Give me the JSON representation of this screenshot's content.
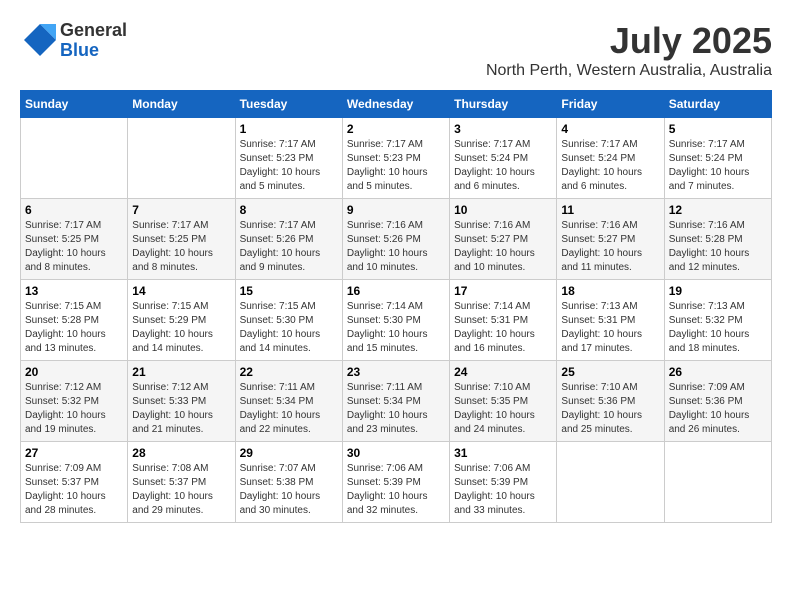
{
  "logo": {
    "line1": "General",
    "line2": "Blue"
  },
  "title": "July 2025",
  "subtitle": "North Perth, Western Australia, Australia",
  "weekdays": [
    "Sunday",
    "Monday",
    "Tuesday",
    "Wednesday",
    "Thursday",
    "Friday",
    "Saturday"
  ],
  "weeks": [
    [
      {
        "day": "",
        "info": ""
      },
      {
        "day": "",
        "info": ""
      },
      {
        "day": "1",
        "info": "Sunrise: 7:17 AM\nSunset: 5:23 PM\nDaylight: 10 hours and 5 minutes."
      },
      {
        "day": "2",
        "info": "Sunrise: 7:17 AM\nSunset: 5:23 PM\nDaylight: 10 hours and 5 minutes."
      },
      {
        "day": "3",
        "info": "Sunrise: 7:17 AM\nSunset: 5:24 PM\nDaylight: 10 hours and 6 minutes."
      },
      {
        "day": "4",
        "info": "Sunrise: 7:17 AM\nSunset: 5:24 PM\nDaylight: 10 hours and 6 minutes."
      },
      {
        "day": "5",
        "info": "Sunrise: 7:17 AM\nSunset: 5:24 PM\nDaylight: 10 hours and 7 minutes."
      }
    ],
    [
      {
        "day": "6",
        "info": "Sunrise: 7:17 AM\nSunset: 5:25 PM\nDaylight: 10 hours and 8 minutes."
      },
      {
        "day": "7",
        "info": "Sunrise: 7:17 AM\nSunset: 5:25 PM\nDaylight: 10 hours and 8 minutes."
      },
      {
        "day": "8",
        "info": "Sunrise: 7:17 AM\nSunset: 5:26 PM\nDaylight: 10 hours and 9 minutes."
      },
      {
        "day": "9",
        "info": "Sunrise: 7:16 AM\nSunset: 5:26 PM\nDaylight: 10 hours and 10 minutes."
      },
      {
        "day": "10",
        "info": "Sunrise: 7:16 AM\nSunset: 5:27 PM\nDaylight: 10 hours and 10 minutes."
      },
      {
        "day": "11",
        "info": "Sunrise: 7:16 AM\nSunset: 5:27 PM\nDaylight: 10 hours and 11 minutes."
      },
      {
        "day": "12",
        "info": "Sunrise: 7:16 AM\nSunset: 5:28 PM\nDaylight: 10 hours and 12 minutes."
      }
    ],
    [
      {
        "day": "13",
        "info": "Sunrise: 7:15 AM\nSunset: 5:28 PM\nDaylight: 10 hours and 13 minutes."
      },
      {
        "day": "14",
        "info": "Sunrise: 7:15 AM\nSunset: 5:29 PM\nDaylight: 10 hours and 14 minutes."
      },
      {
        "day": "15",
        "info": "Sunrise: 7:15 AM\nSunset: 5:30 PM\nDaylight: 10 hours and 14 minutes."
      },
      {
        "day": "16",
        "info": "Sunrise: 7:14 AM\nSunset: 5:30 PM\nDaylight: 10 hours and 15 minutes."
      },
      {
        "day": "17",
        "info": "Sunrise: 7:14 AM\nSunset: 5:31 PM\nDaylight: 10 hours and 16 minutes."
      },
      {
        "day": "18",
        "info": "Sunrise: 7:13 AM\nSunset: 5:31 PM\nDaylight: 10 hours and 17 minutes."
      },
      {
        "day": "19",
        "info": "Sunrise: 7:13 AM\nSunset: 5:32 PM\nDaylight: 10 hours and 18 minutes."
      }
    ],
    [
      {
        "day": "20",
        "info": "Sunrise: 7:12 AM\nSunset: 5:32 PM\nDaylight: 10 hours and 19 minutes."
      },
      {
        "day": "21",
        "info": "Sunrise: 7:12 AM\nSunset: 5:33 PM\nDaylight: 10 hours and 21 minutes."
      },
      {
        "day": "22",
        "info": "Sunrise: 7:11 AM\nSunset: 5:34 PM\nDaylight: 10 hours and 22 minutes."
      },
      {
        "day": "23",
        "info": "Sunrise: 7:11 AM\nSunset: 5:34 PM\nDaylight: 10 hours and 23 minutes."
      },
      {
        "day": "24",
        "info": "Sunrise: 7:10 AM\nSunset: 5:35 PM\nDaylight: 10 hours and 24 minutes."
      },
      {
        "day": "25",
        "info": "Sunrise: 7:10 AM\nSunset: 5:36 PM\nDaylight: 10 hours and 25 minutes."
      },
      {
        "day": "26",
        "info": "Sunrise: 7:09 AM\nSunset: 5:36 PM\nDaylight: 10 hours and 26 minutes."
      }
    ],
    [
      {
        "day": "27",
        "info": "Sunrise: 7:09 AM\nSunset: 5:37 PM\nDaylight: 10 hours and 28 minutes."
      },
      {
        "day": "28",
        "info": "Sunrise: 7:08 AM\nSunset: 5:37 PM\nDaylight: 10 hours and 29 minutes."
      },
      {
        "day": "29",
        "info": "Sunrise: 7:07 AM\nSunset: 5:38 PM\nDaylight: 10 hours and 30 minutes."
      },
      {
        "day": "30",
        "info": "Sunrise: 7:06 AM\nSunset: 5:39 PM\nDaylight: 10 hours and 32 minutes."
      },
      {
        "day": "31",
        "info": "Sunrise: 7:06 AM\nSunset: 5:39 PM\nDaylight: 10 hours and 33 minutes."
      },
      {
        "day": "",
        "info": ""
      },
      {
        "day": "",
        "info": ""
      }
    ]
  ]
}
